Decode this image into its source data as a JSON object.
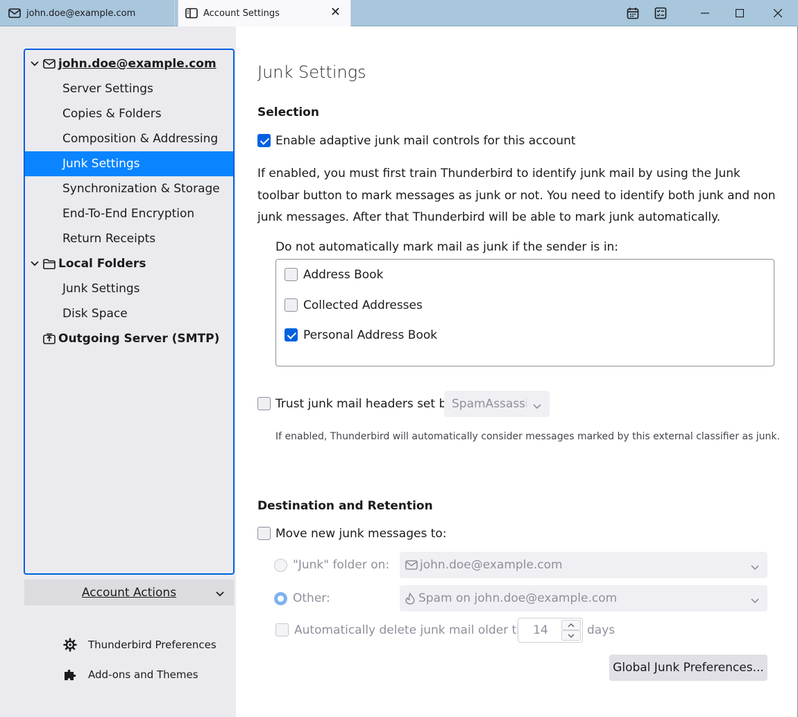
{
  "tabs": [
    {
      "label": "john.doe@example.com",
      "icon": "mail-icon"
    },
    {
      "label": "Account Settings",
      "icon": "settings-tab-icon",
      "close": "close-icon"
    }
  ],
  "window_buttons": [
    "calendar-icon",
    "tasks-icon",
    "minimize-icon",
    "maximize-icon",
    "close-icon"
  ],
  "sidebar": {
    "account": "john.doe@example.com",
    "account_items": [
      "Server Settings",
      "Copies & Folders",
      "Composition & Addressing",
      "Junk Settings",
      "Synchronization & Storage",
      "End-To-End Encryption",
      "Return Receipts"
    ],
    "selected": "Junk Settings",
    "local_folders": "Local Folders",
    "local_items": [
      "Junk Settings",
      "Disk Space"
    ],
    "outgoing": "Outgoing Server (SMTP)",
    "account_actions": "Account Actions",
    "preferences": "Thunderbird Preferences",
    "addons": "Add-ons and Themes"
  },
  "main": {
    "title": "Junk Settings",
    "selection_heading": "Selection",
    "enable_label": "Enable adaptive junk mail controls for this account",
    "enable_checked": true,
    "description": "If enabled, you must first train Thunderbird to identify junk mail by using the Junk toolbar button to mark messages as junk or not. You need to identify both junk and non junk messages. After that Thunderbird will be able to mark junk automatically.",
    "whitelist_label": "Do not automatically mark mail as junk if the sender is in:",
    "address_books": [
      {
        "label": "Address Book",
        "checked": false
      },
      {
        "label": "Collected Addresses",
        "checked": false
      },
      {
        "label": "Personal Address Book",
        "checked": true
      }
    ],
    "trust_label": "Trust junk mail headers set by:",
    "trust_select": "SpamAssassin",
    "trust_note": "If enabled, Thunderbird will automatically consider messages marked by this external classifier as junk.",
    "dest_heading": "Destination and Retention",
    "move_label": "Move new junk messages to:",
    "junk_folder_label": "\"Junk\" folder on:",
    "junk_folder_value": "john.doe@example.com",
    "other_label": "Other:",
    "other_value": "Spam on john.doe@example.com",
    "auto_delete_label": "Automatically delete junk mail older than",
    "days_value": "14",
    "days_label": "days",
    "global_button": "Global Junk Preferences..."
  },
  "colors": {
    "accent": "#0061e0",
    "selection": "#0a84ff",
    "titlebar": "#a8c6dc",
    "sidebar": "#ebebef"
  }
}
